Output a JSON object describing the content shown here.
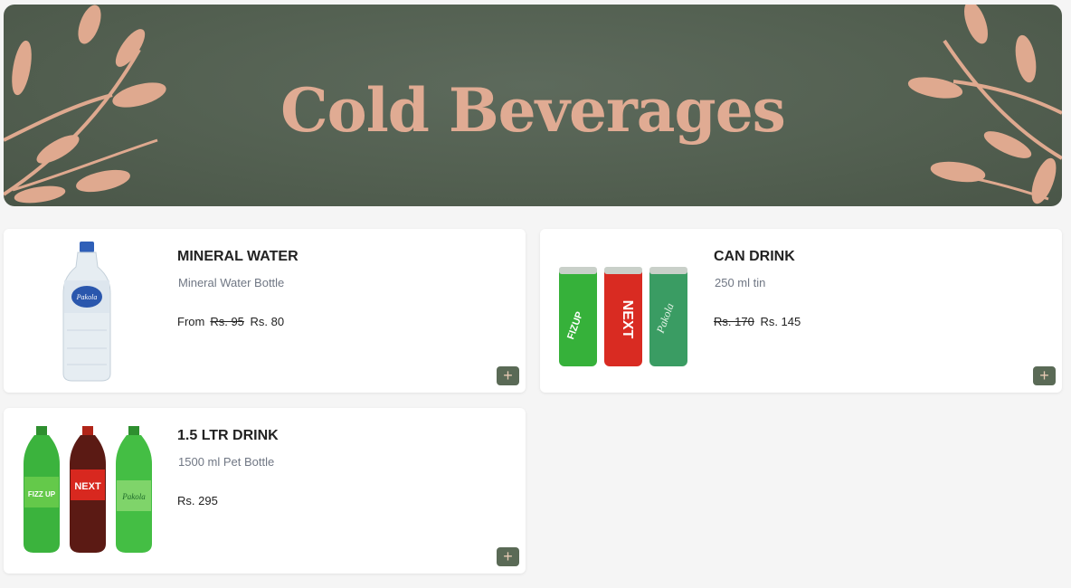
{
  "banner": {
    "title": "Cold Beverages"
  },
  "colors": {
    "banner_bg": "#536051",
    "accent": "#e0ab93",
    "add_button": "#5a6a56"
  },
  "products": [
    {
      "title": "MINERAL WATER",
      "description": "Mineral Water Bottle",
      "from_label": "From",
      "old_price": "Rs. 95",
      "price": "Rs. 80",
      "add_label": "+",
      "image": "water-bottle"
    },
    {
      "title": "CAN DRINK",
      "description": "250 ml tin",
      "old_price": "Rs. 170",
      "price": "Rs. 145",
      "add_label": "+",
      "image": "soda-cans"
    },
    {
      "title": "1.5 LTR DRINK",
      "description": "1500 ml Pet Bottle",
      "price": "Rs. 295",
      "add_label": "+",
      "image": "soda-bottles"
    }
  ],
  "image_labels": {
    "water": "Pakola",
    "can1": "FIZUP",
    "can2": "NEXT",
    "can3": "Pakola",
    "bottle1": "FIZZ UP",
    "bottle2": "NEXT",
    "bottle3": "Pakola"
  }
}
